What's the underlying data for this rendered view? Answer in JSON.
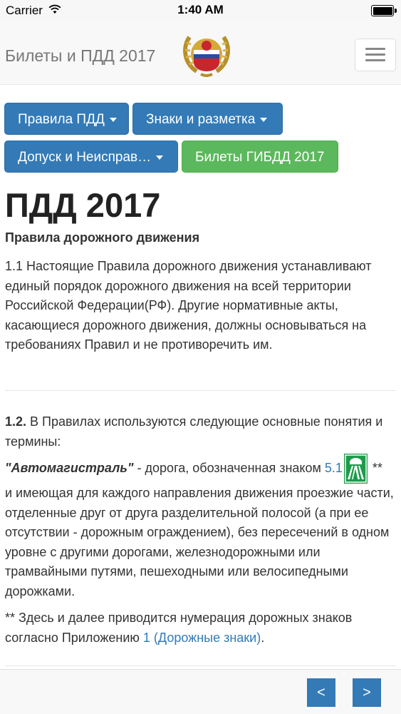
{
  "status_bar": {
    "carrier": "Carrier",
    "time": "1:40 AM"
  },
  "header": {
    "brand": "Билеты и ПДД 2017"
  },
  "menu": {
    "rules": "Правила ПДД",
    "signs": "Знаки и разметка",
    "admission": "Допуск и Неисправ…",
    "tickets": "Билеты ГИБДД 2017"
  },
  "content": {
    "title": "ПДД 2017",
    "subtitle": "Правила дорожного движения",
    "para1": "1.1 Настоящие Правила дорожного движения устанавливают единый порядок дорожного движения на всей территории Российской Федерации(РФ). Другие нормативные акты, касающиеся дорожного движения, должны основываться на требованиях Правил и не противоречить им.",
    "sec2_number": "1.2.",
    "sec2_intro": " В Правилах используются следующие основные понятия и термины:",
    "term": "\"Автомагистраль\"",
    "term_def_a": " - дорога, обозначенная знаком ",
    "sign_link": "5.1",
    "stars": " **",
    "term_def_b": "и имеющая для каждого направления движения проезжие части, отделенные друг от друга разделительной полосой (а при ее отсутствии - дорожным ограждением), без пересечений в одном уровне с другими дорогами, железнодорожными или трамвайными путями, пешеходными или велосипедными дорожками.",
    "note_a": "** Здесь и далее приводится нумерация дорожных знаков согласно Приложению ",
    "note_link": "1 (Дорожные знаки)",
    "note_b": "."
  },
  "footer": {
    "prev": "<",
    "next": ">"
  }
}
